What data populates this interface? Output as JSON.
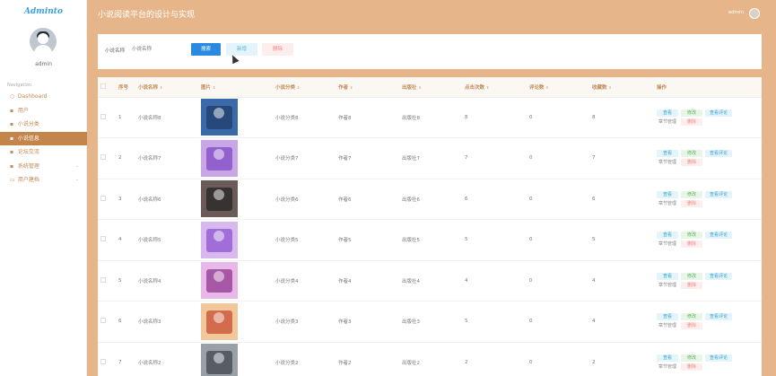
{
  "app": {
    "logo": "Adminto",
    "username": "admin",
    "page_title": "小说阅读平台的设计与实现",
    "header_user": "admin"
  },
  "sidebar": {
    "section_label": "Navigation",
    "items": [
      {
        "label": "Dashboard",
        "icon": "○"
      },
      {
        "label": "用户",
        "icon": "▪"
      },
      {
        "label": "小说分类",
        "icon": "▪"
      },
      {
        "label": "小说信息",
        "icon": "▪"
      },
      {
        "label": "论坛交流",
        "icon": "▪"
      },
      {
        "label": "系统管理",
        "icon": "▪"
      },
      {
        "label": "用户建档",
        "icon": "▭"
      }
    ]
  },
  "search": {
    "label": "小说名称",
    "placeholder": "小说名称",
    "search_btn": "搜索",
    "add_btn": "新增",
    "delete_btn": "删除"
  },
  "table": {
    "headers": [
      "",
      "序号",
      "小说名称",
      "图片",
      "小说分类",
      "作者",
      "出版社",
      "点击次数",
      "评论数",
      "收藏数",
      "操作"
    ],
    "sort_glyph": "⇕",
    "ops": {
      "view": "查看",
      "edit": "修改",
      "comment": "查看评论",
      "chapter": "章节管理",
      "delete": "删除"
    },
    "rows": [
      {
        "no": "1",
        "name": "小说名称8",
        "cat": "小说分类8",
        "author": "作者8",
        "pub": "出版社8",
        "clicks": "8",
        "comments": "0",
        "favs": "8",
        "cover_color": "#3a6aa8",
        "cover_accent": "#1e3a66"
      },
      {
        "no": "2",
        "name": "小说名称7",
        "cat": "小说分类7",
        "author": "作者7",
        "pub": "出版社7",
        "clicks": "7",
        "comments": "0",
        "favs": "7",
        "cover_color": "#c9a6e6",
        "cover_accent": "#7a44c2"
      },
      {
        "no": "3",
        "name": "小说名称6",
        "cat": "小说分类6",
        "author": "作者6",
        "pub": "出版社6",
        "clicks": "6",
        "comments": "0",
        "favs": "6",
        "cover_color": "#6b5a5a",
        "cover_accent": "#222222"
      },
      {
        "no": "4",
        "name": "小说名称5",
        "cat": "小说分类5",
        "author": "作者5",
        "pub": "出版社5",
        "clicks": "5",
        "comments": "0",
        "favs": "5",
        "cover_color": "#d7b8ef",
        "cover_accent": "#8a4fd0"
      },
      {
        "no": "5",
        "name": "小说名称4",
        "cat": "小说分类4",
        "author": "作者4",
        "pub": "出版社4",
        "clicks": "4",
        "comments": "0",
        "favs": "4",
        "cover_color": "#e8b8e8",
        "cover_accent": "#8a2e8a"
      },
      {
        "no": "6",
        "name": "小说名称3",
        "cat": "小说分类3",
        "author": "作者3",
        "pub": "出版社3",
        "clicks": "5",
        "comments": "0",
        "favs": "4",
        "cover_color": "#f2c79a",
        "cover_accent": "#c5462c"
      },
      {
        "no": "7",
        "name": "小说名称2",
        "cat": "小说分类2",
        "author": "作者2",
        "pub": "出版社2",
        "clicks": "2",
        "comments": "0",
        "favs": "2",
        "cover_color": "#9aa0a8",
        "cover_accent": "#3a3f48"
      }
    ]
  }
}
